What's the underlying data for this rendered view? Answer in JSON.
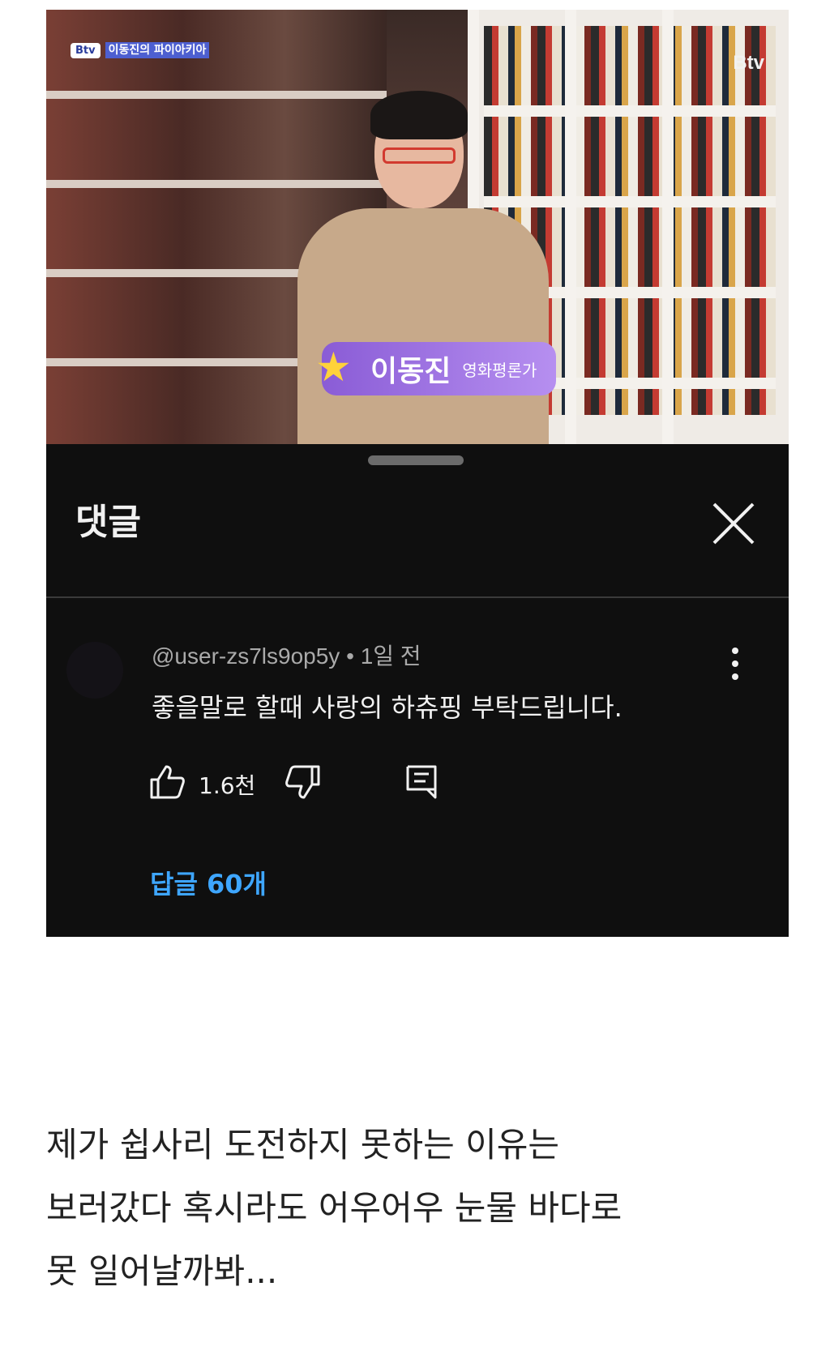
{
  "video": {
    "channel_logo": "Btv",
    "show_logo_b": "Btv",
    "show_logo_title": "이동진의 파이아키아",
    "host_name": "이동진",
    "host_role": "영화평론가"
  },
  "comments_panel": {
    "title": "댓글",
    "comment": {
      "author": "@user-zs7ls9op5y",
      "separator": "•",
      "time": "1일 전",
      "text": "좋을말로 할때 사랑의 하츄핑 부탁드립니다.",
      "likes": "1.6천",
      "replies_label": "답글 60개"
    }
  },
  "caption": {
    "lines": [
      "제가 쉽사리 도전하지 못하는 이유는",
      "보러갔다 혹시라도 어우어우 눈물 바다로",
      "못 일어날까봐..."
    ]
  },
  "colors": {
    "panel_bg": "#0f0f0f",
    "reply_link": "#3ea6ff",
    "name_tag": "#9b6fe3"
  },
  "icons": [
    "close-icon",
    "more-vert-icon",
    "thumb-up-icon",
    "thumb-down-icon",
    "reply-icon",
    "star-icon"
  ]
}
